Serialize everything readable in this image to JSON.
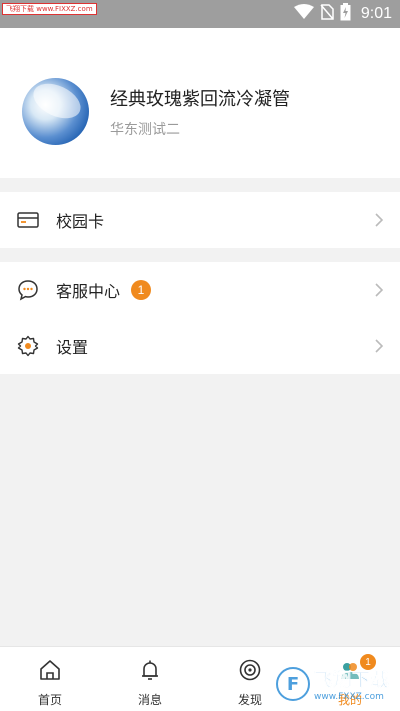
{
  "status_bar": {
    "time": "9:01",
    "watermark_tag": "飞翔下载 www.FIXXZ.com"
  },
  "profile": {
    "name": "经典玫瑰紫回流冷凝管",
    "subtitle": "华东测试二"
  },
  "menu": {
    "campus_card": {
      "label": "校园卡",
      "icon": "card-icon"
    },
    "customer_service": {
      "label": "客服中心",
      "icon": "chat-icon",
      "badge": "1"
    },
    "settings": {
      "label": "设置",
      "icon": "gear-icon"
    }
  },
  "tabbar": {
    "tabs": [
      {
        "label": "首页",
        "icon": "home-icon"
      },
      {
        "label": "消息",
        "icon": "bell-icon"
      },
      {
        "label": "发现",
        "icon": "discover-icon"
      },
      {
        "label": "我的",
        "icon": "profile-icon",
        "badge": "1"
      }
    ]
  },
  "watermark": {
    "logo_text": "飞翔下载",
    "logo_url": "www.FXXZ.com",
    "logo_mark": "F"
  },
  "colors": {
    "accent": "#f08a1e",
    "status_bar": "#9e9e9e",
    "background": "#f2f2f2",
    "watermark_blue": "#2f8fd8"
  }
}
